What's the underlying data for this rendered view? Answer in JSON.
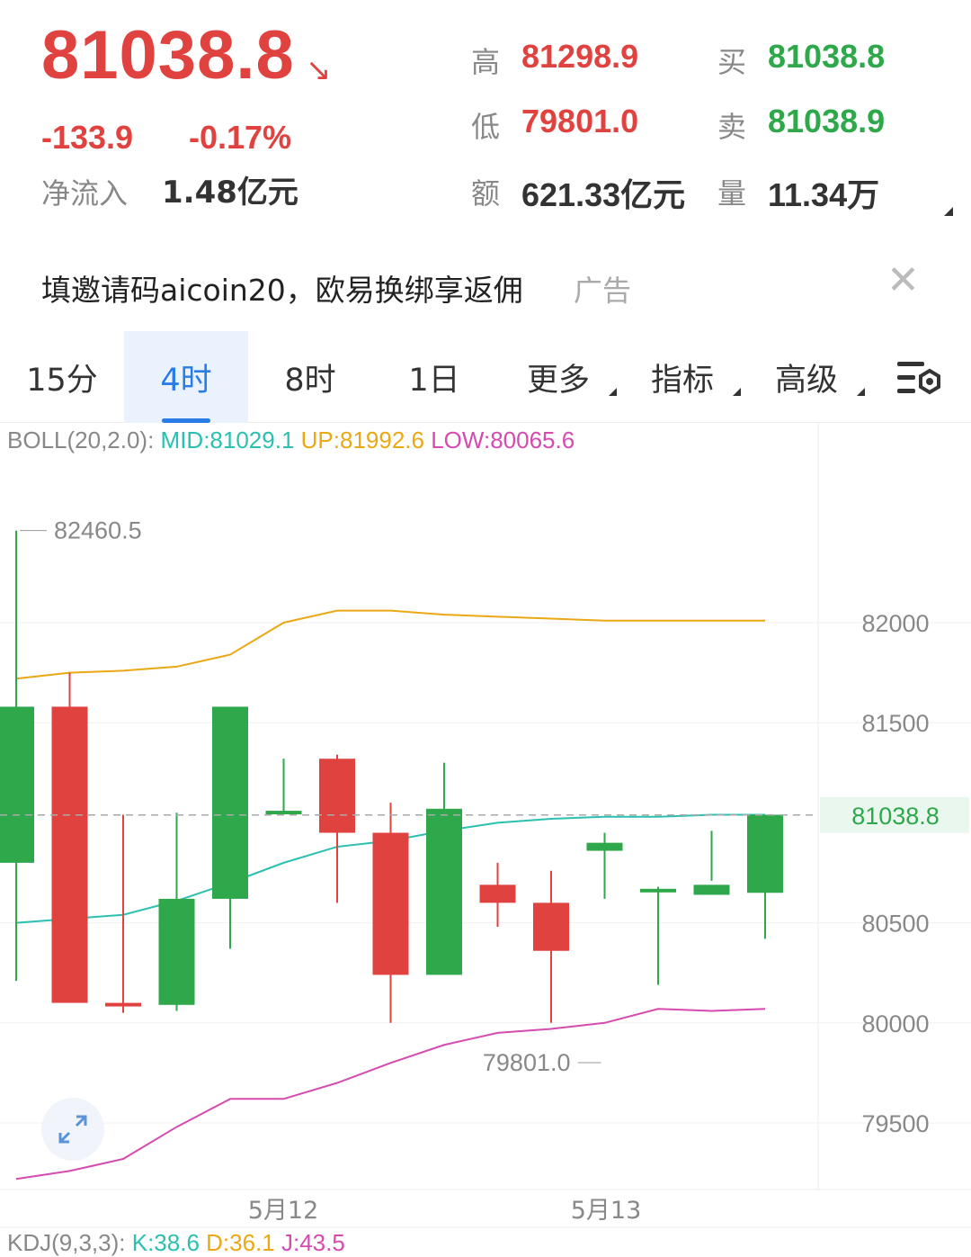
{
  "header": {
    "price": "81038.8",
    "price_arrow": "↘",
    "change": "-133.9",
    "change_pct": "-0.17%",
    "inflow_label": "净流入",
    "inflow_value": "1.48亿元",
    "high_label": "高",
    "high_value": "81298.9",
    "low_label": "低",
    "low_value": "79801.0",
    "amount_label": "额",
    "amount_value": "621.33亿元",
    "bid_label": "买",
    "bid_value": "81038.8",
    "ask_label": "卖",
    "ask_value": "81038.9",
    "volume_label": "量",
    "volume_value": "11.34万"
  },
  "ad": {
    "text": "填邀请码aicoin20，欧易换绑享返佣",
    "tag": "广告",
    "close_icon": "close-icon"
  },
  "tabs": [
    {
      "label": "15分",
      "active": false
    },
    {
      "label": "4时",
      "active": true
    },
    {
      "label": "8时",
      "active": false
    },
    {
      "label": "1日",
      "active": false
    },
    {
      "label": "更多",
      "active": false,
      "dropdown": true
    },
    {
      "label": "指标",
      "active": false,
      "dropdown": true
    },
    {
      "label": "高级",
      "active": false,
      "dropdown": true
    }
  ],
  "indicators": {
    "boll_name": "BOLL(20,2.0):",
    "boll_mid": "MID:81029.1",
    "boll_up": "UP:81992.6",
    "boll_low": "LOW:80065.6",
    "kdj_name": "KDJ(9,3,3):",
    "kdj_k": "K:38.6",
    "kdj_d": "D:36.1",
    "kdj_j": "J:43.5"
  },
  "colors": {
    "up": "#2ea84a",
    "down": "#e0433f",
    "mid": "#2bc0b0",
    "upper": "#eaa814",
    "lower": "#d54bb0",
    "accent": "#2a7ce6"
  },
  "chart_data": {
    "type": "candlestick",
    "y_ticks": [
      82000,
      81500,
      80500,
      80000,
      79500
    ],
    "ylim": [
      79250,
      82900
    ],
    "x_labels": [
      "5月12",
      "5月13"
    ],
    "current_price": "81038.8",
    "max_marker": "82460.5",
    "min_marker": "79801.0",
    "candles": [
      {
        "o": 80800,
        "h": 82460,
        "l": 80210,
        "c": 81580
      },
      {
        "o": 81580,
        "h": 81750,
        "l": 80460,
        "c": 80100
      },
      {
        "o": 80100,
        "h": 81040,
        "l": 80050,
        "c": 80090
      },
      {
        "o": 80090,
        "h": 81050,
        "l": 80060,
        "c": 80620
      },
      {
        "o": 80620,
        "h": 81360,
        "l": 80370,
        "c": 81580
      },
      {
        "o": 81060,
        "h": 81320,
        "l": 81050,
        "c": 81060
      },
      {
        "o": 81320,
        "h": 81340,
        "l": 80600,
        "c": 80950
      },
      {
        "o": 80950,
        "h": 81100,
        "l": 80000,
        "c": 80240
      },
      {
        "o": 80240,
        "h": 81300,
        "l": 80510,
        "c": 81070
      },
      {
        "o": 80690,
        "h": 80800,
        "l": 80480,
        "c": 80600
      },
      {
        "o": 80600,
        "h": 80760,
        "l": 80000,
        "c": 80360
      },
      {
        "o": 80860,
        "h": 80950,
        "l": 80620,
        "c": 80900
      },
      {
        "o": 80670,
        "h": 80680,
        "l": 80190,
        "c": 80670
      },
      {
        "o": 80640,
        "h": 80960,
        "l": 80710,
        "c": 80690
      },
      {
        "o": 80650,
        "h": 80950,
        "l": 80420,
        "c": 81040
      }
    ],
    "boll_mid_series": [
      80500,
      80520,
      80540,
      80610,
      80700,
      80800,
      80880,
      80910,
      80960,
      81000,
      81020,
      81030,
      81030,
      81040,
      81040
    ],
    "boll_up_series": [
      81720,
      81750,
      81760,
      81780,
      81840,
      82000,
      82060,
      82060,
      82040,
      82030,
      82020,
      82010,
      82010,
      82010,
      82010
    ],
    "boll_low_series": [
      79220,
      79260,
      79320,
      79480,
      79620,
      79620,
      79700,
      79800,
      79890,
      79950,
      79970,
      80000,
      80070,
      80060,
      80070
    ]
  }
}
